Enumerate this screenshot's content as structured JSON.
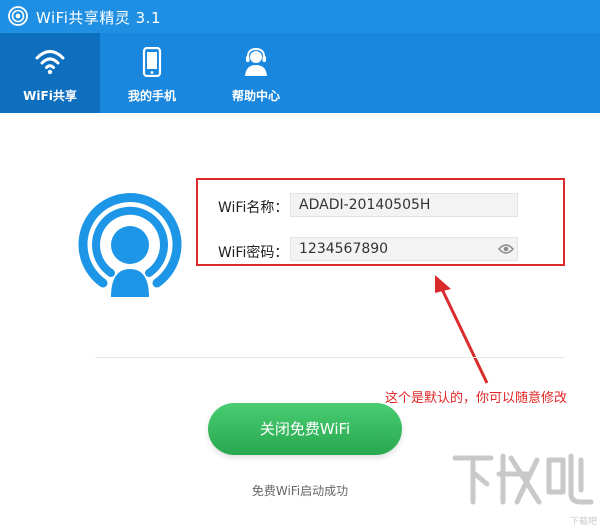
{
  "app": {
    "title": "WiFi共享精灵 3.1"
  },
  "nav": {
    "items": [
      {
        "label": "WiFi共享",
        "icon": "wifi-icon",
        "active": true
      },
      {
        "label": "我的手机",
        "icon": "phone-icon",
        "active": false
      },
      {
        "label": "帮助中心",
        "icon": "support-agent-icon",
        "active": false
      }
    ]
  },
  "form": {
    "name_label": "WiFi名称：",
    "name_value": "ADADI-20140505H",
    "password_label": "WiFi密码：",
    "password_value": "1234567890"
  },
  "annotation": {
    "text": "这个是默认的，你可以随意修改"
  },
  "action": {
    "button_label": "关闭免费WiFi",
    "status_text": "免费WiFi启动成功"
  },
  "watermark": {
    "text": "下载吧"
  },
  "colors": {
    "titlebar": "#1f8fe3",
    "navbar": "#1a87de",
    "nav_active": "#0f6fbf",
    "highlight_box": "#d92b2b",
    "button_green": "#2fb65a",
    "logo_blue": "#1e96e8"
  }
}
